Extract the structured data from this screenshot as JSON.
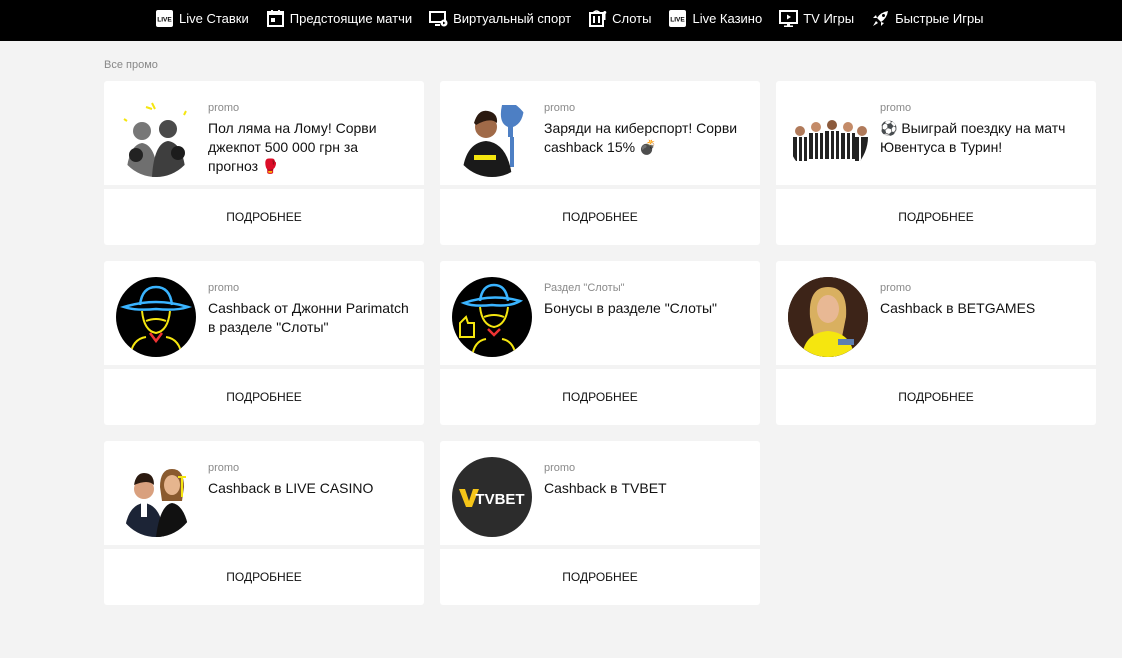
{
  "nav": [
    {
      "label": "Live Ставки",
      "icon": "live-badge-icon"
    },
    {
      "label": "Предстоящие матчи",
      "icon": "calendar-icon"
    },
    {
      "label": "Виртуальный спорт",
      "icon": "monitor-play-icon"
    },
    {
      "label": "Слоты",
      "icon": "slot-machine-icon"
    },
    {
      "label": "Live Казино",
      "icon": "live-badge-icon"
    },
    {
      "label": "TV Игры",
      "icon": "tv-icon"
    },
    {
      "label": "Быстрые Игры",
      "icon": "rocket-icon"
    }
  ],
  "live_badge_text": "LIVE",
  "section_title": "Все промо",
  "more_label": "ПОДРОБНЕЕ",
  "promos": [
    {
      "tag": "promo",
      "title": "Пол ляма на Лому! Сорви джекпот 500 000 грн за прогноз 🥊",
      "image": "boxers-image"
    },
    {
      "tag": "promo",
      "title": "Заряди на киберспорт! Сорви cashback 15% 💣",
      "image": "esports-player-trophy-image"
    },
    {
      "tag": "promo",
      "title": "⚽ Выиграй поездку на матч Ювентуса в Турин!",
      "image": "juventus-players-image"
    },
    {
      "tag": "promo",
      "title": "Cashback от Джонни Parimatch в разделе \"Слоты\"",
      "image": "neon-cowboy-image"
    },
    {
      "tag": "Раздел \"Слоты\"",
      "title": "Бонусы в разделе \"Слоты\"",
      "image": "neon-cowboy-thumbs-up-image"
    },
    {
      "tag": "promo",
      "title": "Cashback в BETGAMES",
      "image": "betgames-dealer-image"
    },
    {
      "tag": "promo",
      "title": "Cashback в LIVE CASINO",
      "image": "live-casino-dealers-image"
    },
    {
      "tag": "promo",
      "title": "Cashback в TVBET",
      "image": "tvbet-logo-image",
      "logo_text": "TVBET"
    }
  ],
  "colors": {
    "topbar": "#000000",
    "page_bg": "#f3f3f3",
    "card_bg": "#ffffff",
    "neon_yellow": "#f5e60f",
    "neon_blue": "#3ab4ff"
  }
}
